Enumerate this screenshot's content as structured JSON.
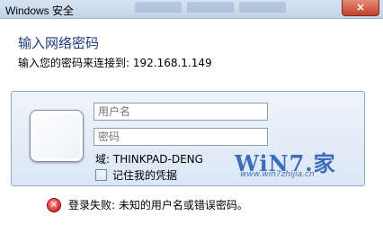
{
  "window": {
    "title": "Windows 安全",
    "close_label": "×"
  },
  "dialog": {
    "heading": "输入网络密码",
    "subtext": "输入您的密码来连接到: 192.168.1.149"
  },
  "credentials": {
    "username_placeholder": "用户名",
    "password_placeholder": "密码",
    "domain_text": "域: THINKPAD-DENG",
    "remember_label": "记住我的凭据",
    "remember_checked": false
  },
  "watermark": {
    "logo_text": "WiN7.家",
    "url": "www.win7zhijia.cn"
  },
  "error": {
    "message": "登录失败: 未知的用户名或错误密码。",
    "icon": "error-icon"
  }
}
